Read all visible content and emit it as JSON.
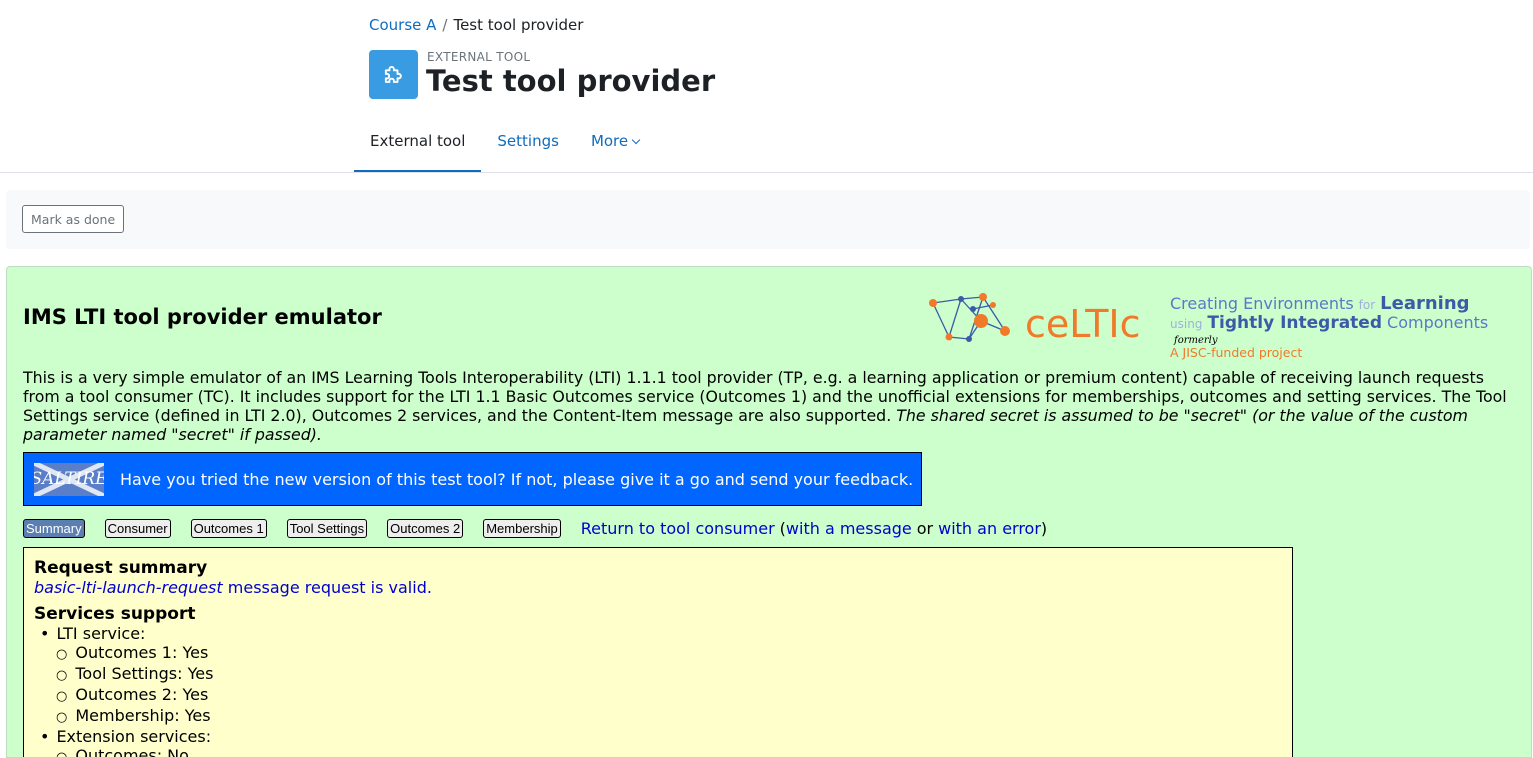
{
  "breadcrumb": {
    "course": "Course A",
    "separator": "/",
    "current": "Test tool provider"
  },
  "activity": {
    "type": "EXTERNAL TOOL",
    "title": "Test tool provider",
    "icon": "puzzle-piece-icon"
  },
  "tabs": [
    {
      "label": "External tool"
    },
    {
      "label": "Settings"
    },
    {
      "label": "More"
    }
  ],
  "completion": {
    "mark_done": "Mark as done"
  },
  "tool": {
    "title": "IMS LTI tool provider emulator",
    "logo": {
      "brand": "ceLTIc",
      "line1a": "Creating Environments",
      "line1b": "for",
      "line1c": "Learning",
      "line2a": "using",
      "line2b": "Tightly Integrated",
      "line2c": "Components",
      "formerly": "formerly",
      "project": "A JISC-funded project"
    },
    "intro_plain": "This is a very simple emulator of an IMS Learning Tools Interoperability (LTI) 1.1.1 tool provider (TP, e.g. a learning application or premium content) capable of receiving launch requests from a tool consumer (TC). It includes support for the LTI 1.1 Basic Outcomes service (Outcomes 1) and the unofficial extensions for memberships, outcomes and setting services. The Tool Settings service (defined in LTI 2.0), Outcomes 2 services, and the Content-Item message are also supported.",
    "intro_italic": "The shared secret is assumed to be \"secret\" (or the value of the custom parameter named \"secret\" if passed).",
    "banner": {
      "logo": "SALTIRE",
      "text": "Have you tried the new version of this test tool? If not, please give it a go and send your feedback."
    },
    "tabs": [
      "Summary",
      "Consumer",
      "Outcomes 1",
      "Tool Settings",
      "Outcomes 2",
      "Membership"
    ],
    "return_link": "Return to tool consumer",
    "with_message": "with a message",
    "or": "or",
    "with_error": "with an error",
    "summary": {
      "heading": "Request summary",
      "valid_type": "basic-lti-launch-request",
      "valid_text": "message request is valid.",
      "services_heading": "Services support",
      "lti_service": "LTI service:",
      "lti_items": [
        "Outcomes 1: Yes",
        "Tool Settings: Yes",
        "Outcomes 2: Yes",
        "Membership: Yes"
      ],
      "ext_service": "Extension services:",
      "ext_items": [
        "Outcomes: No"
      ]
    }
  }
}
